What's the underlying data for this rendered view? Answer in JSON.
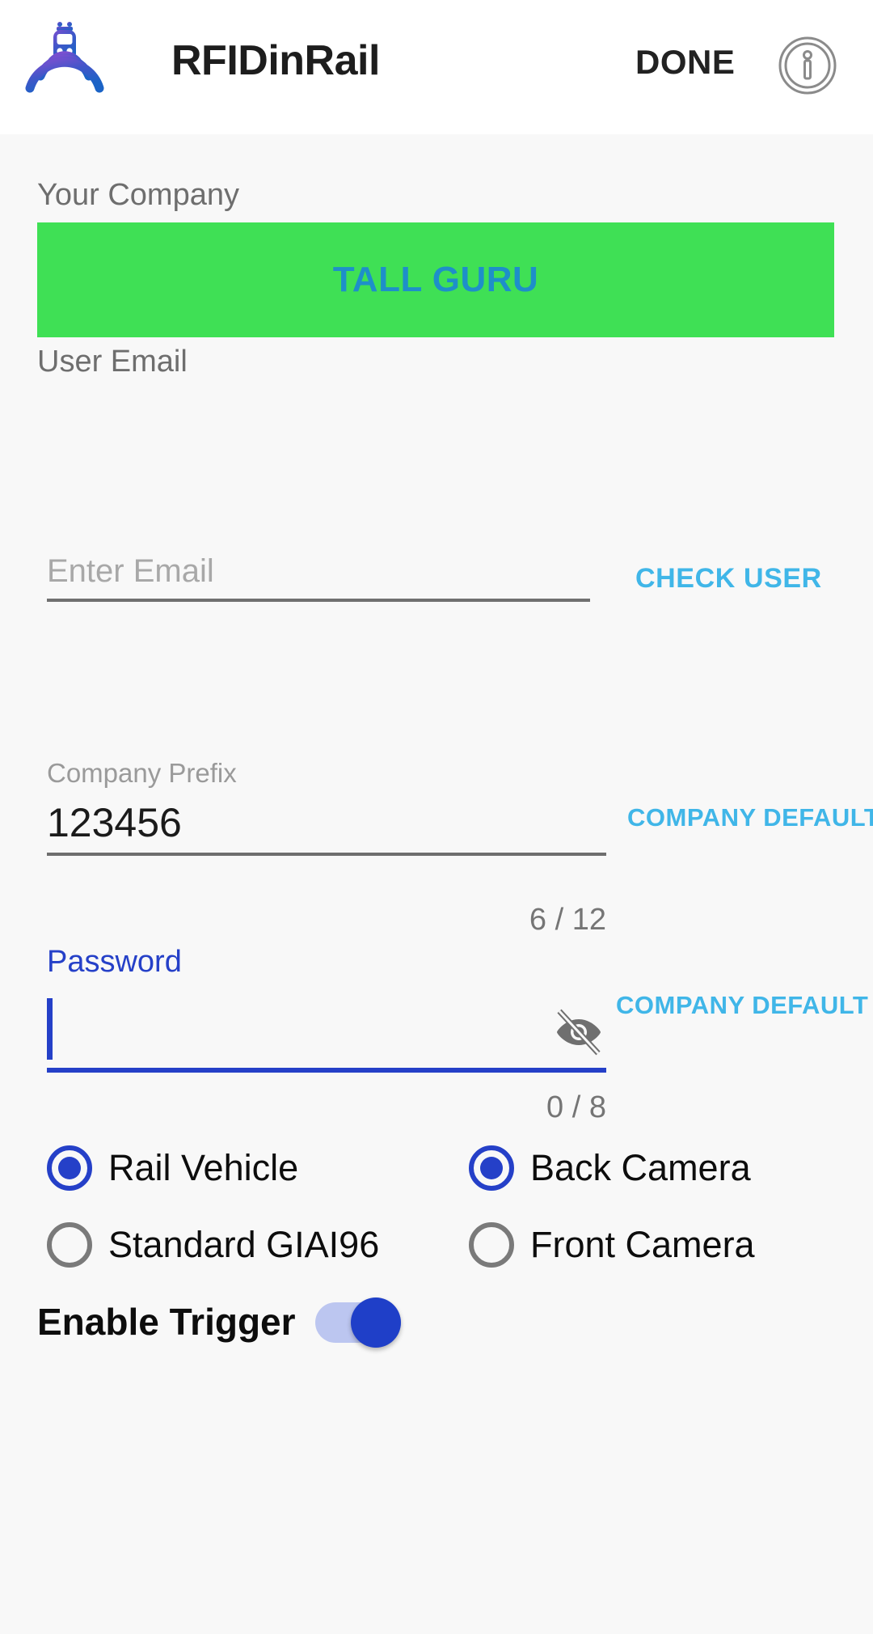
{
  "app": {
    "title": "RFIDinRail",
    "logo_icon": "train-rfid-logo-icon",
    "background_color": "#f8f8f8",
    "appbar_color": "#ffffff"
  },
  "appbar": {
    "done_label": "DONE",
    "info_icon": "info-circle-icon"
  },
  "company": {
    "label": "Your Company",
    "banner_text": "TALL GURU",
    "banner_color": "#3fe055",
    "banner_text_color": "#1e8fc9"
  },
  "email": {
    "label": "User Email",
    "placeholder": "Enter Email",
    "value": "",
    "check_user_label": "CHECK USER",
    "link_color": "#40b6e8"
  },
  "prefix": {
    "label": "Company Prefix",
    "value": "123456",
    "default_label": "COMPANY DEFAULT",
    "counter": "6 / 12"
  },
  "password": {
    "label": "Password",
    "value": "",
    "placeholder": "",
    "default_label": "COMPANY DEFAULT",
    "counter": "0 / 8",
    "visibility_icon": "eye-off-icon",
    "focus_color": "#2540c8"
  },
  "radios": {
    "tag_type": [
      {
        "label": "Rail Vehicle",
        "checked": true
      },
      {
        "label": "Standard GIAI96",
        "checked": false
      }
    ],
    "camera": [
      {
        "label": "Back Camera",
        "checked": true
      },
      {
        "label": "Front Camera",
        "checked": false
      }
    ],
    "selected_color": "#2540c8",
    "unselected_color": "#7a7a7a"
  },
  "trigger": {
    "label": "Enable Trigger",
    "enabled": true,
    "on_color": "#1f3fc8",
    "track_color": "#bcc6f0"
  }
}
